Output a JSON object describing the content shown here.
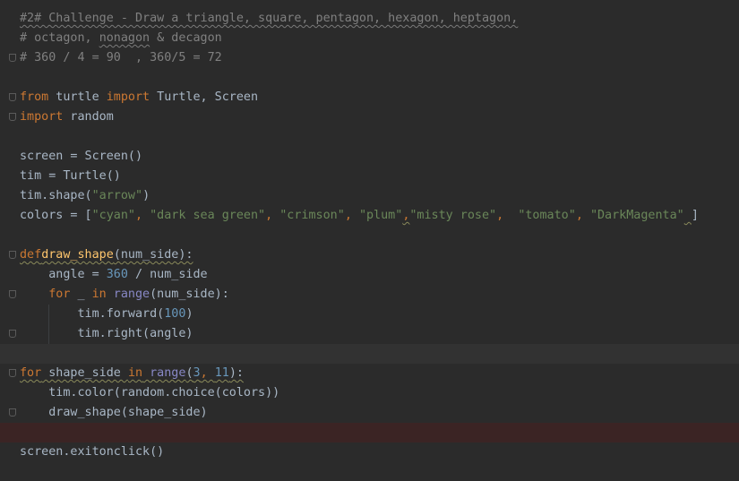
{
  "code": {
    "l1": "#2# Challenge - Draw a triangle, square, pentagon, hexagon, heptagon,",
    "l2a": "# octagon, ",
    "l2b": "nonagon",
    "l2c": " & decagon",
    "l3": "# 360 / 4 = 90  , 360/5 = 72",
    "l5_from": "from",
    "l5_mod": " turtle ",
    "l5_import": "import",
    "l5_names": " Turtle, Screen",
    "l6_import": "import",
    "l6_mod": " random",
    "l8": "screen = Screen()",
    "l9": "tim = Turtle()",
    "l10a": "tim.shape(",
    "l10b": "\"arrow\"",
    "l10c": ")",
    "l11a": "colors = [",
    "l11_cyan": "\"cyan\"",
    "l11_dsg": "\"dark sea green\"",
    "l11_crimson": "\"crimson\"",
    "l11_plum": "\"plum\"",
    "l11_misty": "\"misty rose\"",
    "l11_tomato": "\"tomato\"",
    "l11_dm": "\"DarkMagenta\"",
    "l13_def": "def",
    "l13_fn": "draw_shape",
    "l13_rest": "(num_side):",
    "l14a": "    angle = ",
    "l14n": "360",
    "l14b": " / num_side",
    "l15_for": "    for",
    "l15_mid": " _ ",
    "l15_in": "in",
    "l15_range": " range",
    "l15_rest": "(num_side):",
    "l16a": "        tim.forward(",
    "l16n": "100",
    "l16b": ")",
    "l17": "        tim.right(angle)",
    "l19_for": "for",
    "l19_var": " shape_side ",
    "l19_in": "in",
    "l19_range": " range",
    "l19_open": "(",
    "l19_n1": "3",
    "l19_sep": ", ",
    "l19_n2": "11",
    "l19_close": "):",
    "l20": "    tim.color(random.choice(colors))",
    "l21": "    draw_shape(shape_side)",
    "l23": "screen.exitonclick()"
  },
  "colors": {
    "background": "#2b2b2b",
    "keyword": "#cc7832",
    "string": "#6a8759",
    "number": "#6897bb",
    "comment": "#808080",
    "function": "#ffc66d",
    "builtin": "#8888c6",
    "plain": "#a9b7c6"
  }
}
